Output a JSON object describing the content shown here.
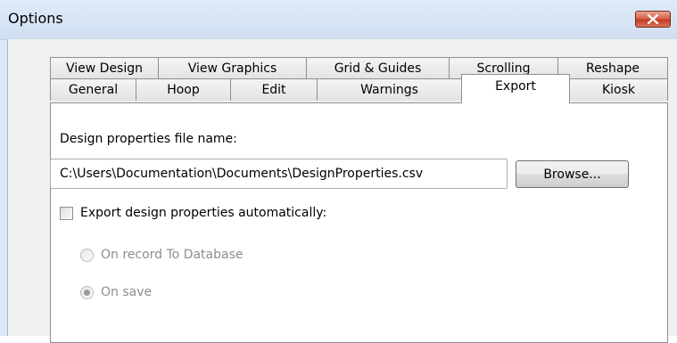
{
  "window": {
    "title": "Options"
  },
  "tabs": {
    "row_back": [
      {
        "label": "View Design"
      },
      {
        "label": "View Graphics"
      },
      {
        "label": "Grid & Guides"
      },
      {
        "label": "Scrolling"
      },
      {
        "label": "Reshape"
      }
    ],
    "row_front": [
      {
        "label": "General"
      },
      {
        "label": "Hoop"
      },
      {
        "label": "Edit"
      },
      {
        "label": "Warnings"
      },
      {
        "label": "Export",
        "selected": true
      },
      {
        "label": "Kiosk"
      }
    ]
  },
  "export": {
    "filename_label": "Design properties file name:",
    "filename_value": "C:\\Users\\Documentation\\Documents\\DesignProperties.csv",
    "browse_label": "Browse...",
    "auto_export_label": "Export design properties automatically:",
    "auto_export_checked": false,
    "options": [
      {
        "label": "On record To Database",
        "selected": false,
        "enabled": false
      },
      {
        "label": "On save",
        "selected": true,
        "enabled": false
      }
    ]
  },
  "icons": {
    "close": "close-x-icon"
  },
  "colors": {
    "titlebar": "#d5e3f3",
    "close_button": "#c94a33",
    "panel": "#ffffff",
    "disabled_text": "#8d8d8d"
  }
}
